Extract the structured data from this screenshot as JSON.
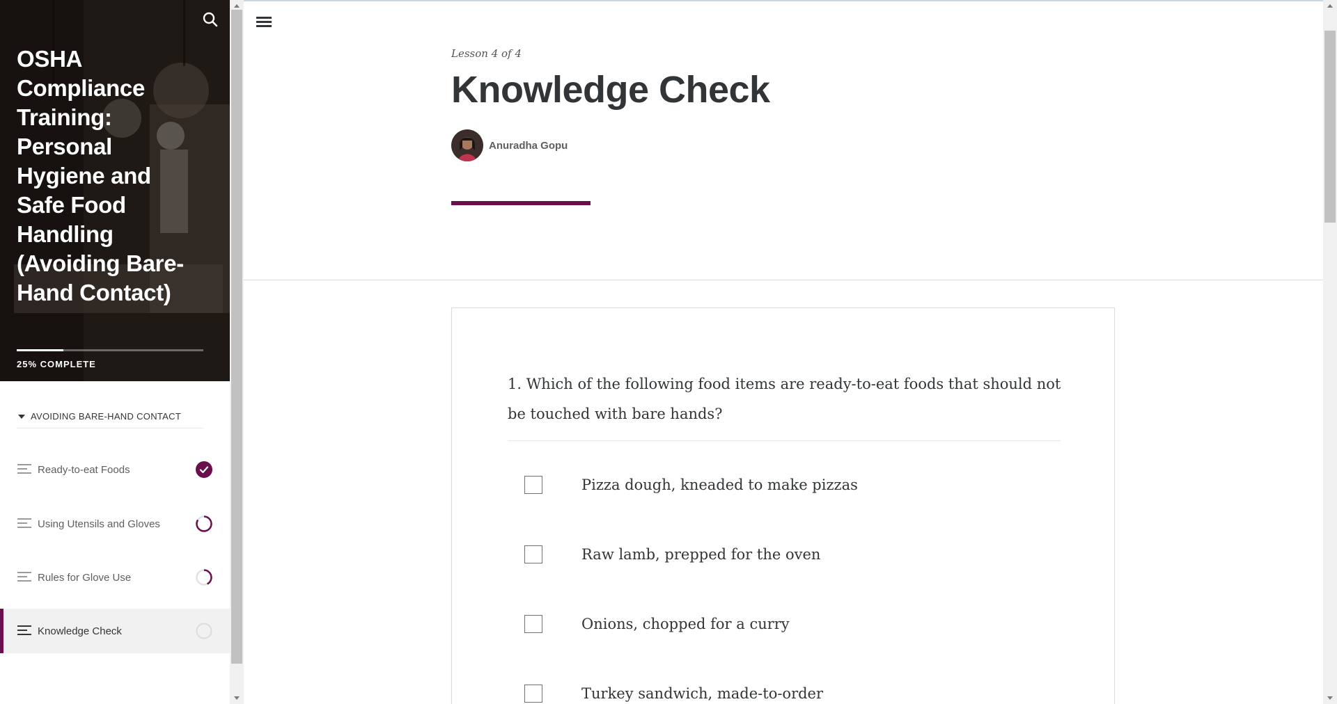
{
  "sidebar": {
    "course_title": "OSHA Compliance Training: Personal Hygiene and Safe Food Handling (Avoiding Bare-Hand Contact)",
    "progress": {
      "percent": 25,
      "label": "25% COMPLETE"
    },
    "section": {
      "label": "AVOIDING BARE-HAND CONTACT",
      "expanded": true
    },
    "lessons": [
      {
        "label": "Ready-to-eat Foods",
        "status": "complete"
      },
      {
        "label": "Using Utensils and Gloves",
        "status": "in-progress"
      },
      {
        "label": "Rules for Glove Use",
        "status": "partial"
      },
      {
        "label": "Knowledge Check",
        "status": "not-started",
        "active": true
      }
    ],
    "icons": {
      "search": "search-icon",
      "caret": "caret-down-icon",
      "lesson": "lesson-lines-icon"
    }
  },
  "main": {
    "lesson_count": "Lesson 4 of 4",
    "title": "Knowledge Check",
    "author": "Anuradha Gopu",
    "question": "1. Which of the following food items are ready-to-eat foods that should not be touched with bare hands?",
    "choices": [
      "Pizza dough, kneaded to make pizzas",
      "Raw lamb, prepped for the oven",
      "Onions, chopped for a curry",
      "Turkey sandwich, made-to-order"
    ]
  },
  "colors": {
    "accent": "#6b0f4c",
    "text": "#313537",
    "muted": "#5b5f61"
  }
}
